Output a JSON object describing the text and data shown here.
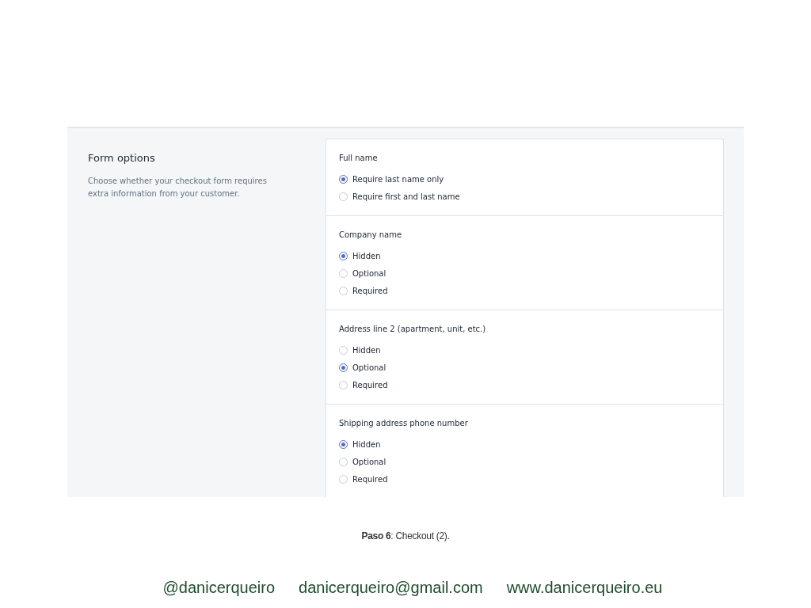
{
  "panel": {
    "title": "Form options",
    "description": "Choose whether your checkout form requires extra information from your customer."
  },
  "sections": [
    {
      "title": "Full name",
      "options": [
        {
          "label": "Require last name only",
          "selected": true
        },
        {
          "label": "Require first and last name",
          "selected": false
        }
      ]
    },
    {
      "title": "Company name",
      "options": [
        {
          "label": "Hidden",
          "selected": true
        },
        {
          "label": "Optional",
          "selected": false
        },
        {
          "label": "Required",
          "selected": false
        }
      ]
    },
    {
      "title": "Address line 2 (apartment, unit, etc.)",
      "options": [
        {
          "label": "Hidden",
          "selected": false
        },
        {
          "label": "Optional",
          "selected": true
        },
        {
          "label": "Required",
          "selected": false
        }
      ]
    },
    {
      "title": "Shipping address phone number",
      "options": [
        {
          "label": "Hidden",
          "selected": true
        },
        {
          "label": "Optional",
          "selected": false
        },
        {
          "label": "Required",
          "selected": false
        }
      ]
    }
  ],
  "caption": "**Paso 6**: Checkout (2).",
  "footer": [
    "@danicerqueiro",
    "danicerqueiro@gmail.com",
    "www.danicerqueiro.eu"
  ]
}
